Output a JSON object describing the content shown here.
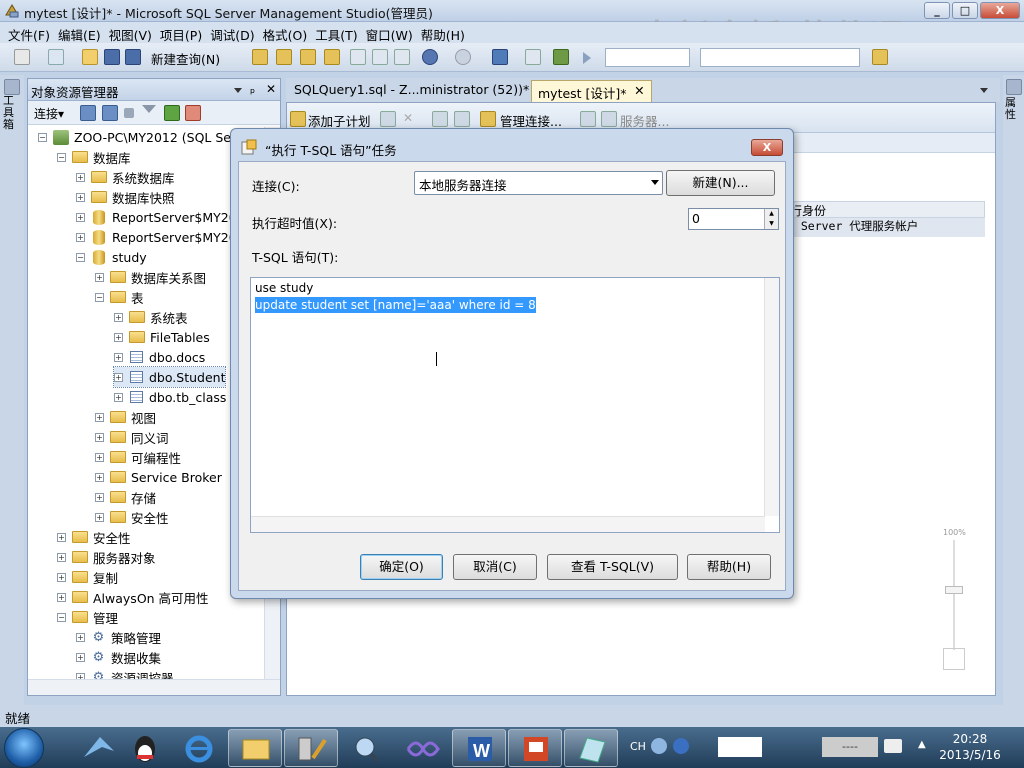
{
  "window": {
    "title": "mytest [设计]* - Microsoft SQL Server Management Studio(管理员)",
    "watermark": "中新金桥 软件通",
    "min": "_",
    "max": "□",
    "close": "X"
  },
  "menu": [
    "文件(F)",
    "编辑(E)",
    "视图(V)",
    "项目(P)",
    "调试(D)",
    "格式(O)",
    "工具(T)",
    "窗口(W)",
    "帮助(H)"
  ],
  "toolbar": {
    "new_query": "新建查询(N)"
  },
  "left_dock_tab": "工具箱",
  "right_dock_tab": "属性",
  "object_explorer": {
    "title": "对象资源管理器",
    "pin": "ₚ",
    "close": "✕",
    "connect_label": "连接▾",
    "tree": [
      {
        "label": "ZOO-PC\\MY2012 (SQL Server",
        "icon": "server-icon",
        "expanded": true
      },
      {
        "label": "数据库",
        "icon": "folder-icon",
        "expanded": true
      },
      {
        "label": "系统数据库",
        "icon": "folder-icon",
        "expanded": false
      },
      {
        "label": "数据库快照",
        "icon": "folder-icon",
        "expanded": false
      },
      {
        "label": "ReportServer$MY2012",
        "icon": "database-icon",
        "expanded": false
      },
      {
        "label": "ReportServer$MY2012",
        "icon": "database-icon",
        "expanded": false
      },
      {
        "label": "study",
        "icon": "database-icon",
        "expanded": true
      },
      {
        "label": "数据库关系图",
        "icon": "folder-icon",
        "expanded": false
      },
      {
        "label": "表",
        "icon": "folder-icon",
        "expanded": true
      },
      {
        "label": "系统表",
        "icon": "folder-icon",
        "expanded": false
      },
      {
        "label": "FileTables",
        "icon": "folder-icon",
        "expanded": false
      },
      {
        "label": "dbo.docs",
        "icon": "table-icon",
        "expanded": false
      },
      {
        "label": "dbo.Student",
        "icon": "table-icon",
        "expanded": false
      },
      {
        "label": "dbo.tb_class",
        "icon": "table-icon",
        "expanded": false
      },
      {
        "label": "视图",
        "icon": "folder-icon",
        "expanded": false
      },
      {
        "label": "同义词",
        "icon": "folder-icon",
        "expanded": false
      },
      {
        "label": "可编程性",
        "icon": "folder-icon",
        "expanded": false
      },
      {
        "label": "Service Broker",
        "icon": "folder-icon",
        "expanded": false
      },
      {
        "label": "存储",
        "icon": "folder-icon",
        "expanded": false
      },
      {
        "label": "安全性",
        "icon": "folder-icon",
        "expanded": false
      },
      {
        "label": "安全性",
        "icon": "folder-icon",
        "expanded": false
      },
      {
        "label": "服务器对象",
        "icon": "folder-icon",
        "expanded": false
      },
      {
        "label": "复制",
        "icon": "folder-icon",
        "expanded": false
      },
      {
        "label": "AlwaysOn 高可用性",
        "icon": "folder-icon",
        "expanded": false
      },
      {
        "label": "管理",
        "icon": "folder-icon",
        "expanded": true
      },
      {
        "label": "策略管理",
        "icon": "gear-icon",
        "expanded": false
      },
      {
        "label": "数据收集",
        "icon": "gear-icon",
        "expanded": false
      },
      {
        "label": "资源调控器",
        "icon": "gear-icon",
        "expanded": false
      }
    ]
  },
  "doc_tabs": [
    {
      "label": "SQLQuery1.sql - Z...ministrator (52))*",
      "active": false
    },
    {
      "label": "mytest [设计]*",
      "active": true
    }
  ],
  "designer": {
    "add_subplan": "添加子计划",
    "manage_connections": "管理连接...",
    "servers": "服务器...",
    "grid_header": "行身份",
    "grid_value": "L Server 代理服务帐户",
    "zoom": "100%"
  },
  "dialog": {
    "title": "“执行 T-SQL 语句”任务",
    "close": "X",
    "connection_label": "连接(C):",
    "connection_value": "本地服务器连接",
    "new_button": "新建(N)...",
    "timeout_label": "执行超时值(X):",
    "timeout_value": "0",
    "tsql_label": "T-SQL 语句(T):",
    "sql_lines": [
      "use study",
      "update student set [name]='aaa' where id = 8"
    ],
    "ok": "确定(O)",
    "cancel": "取消(C)",
    "view_tsql": "查看 T-SQL(V)",
    "help": "帮助(H)"
  },
  "status": {
    "text": "就绪"
  },
  "taskbar": {
    "ime": "CH",
    "time": "20:28",
    "date": "2013/5/16",
    "battery_text": "----"
  },
  "colors": {
    "selection": "#3399ff",
    "accent": "#c8d6e8"
  }
}
